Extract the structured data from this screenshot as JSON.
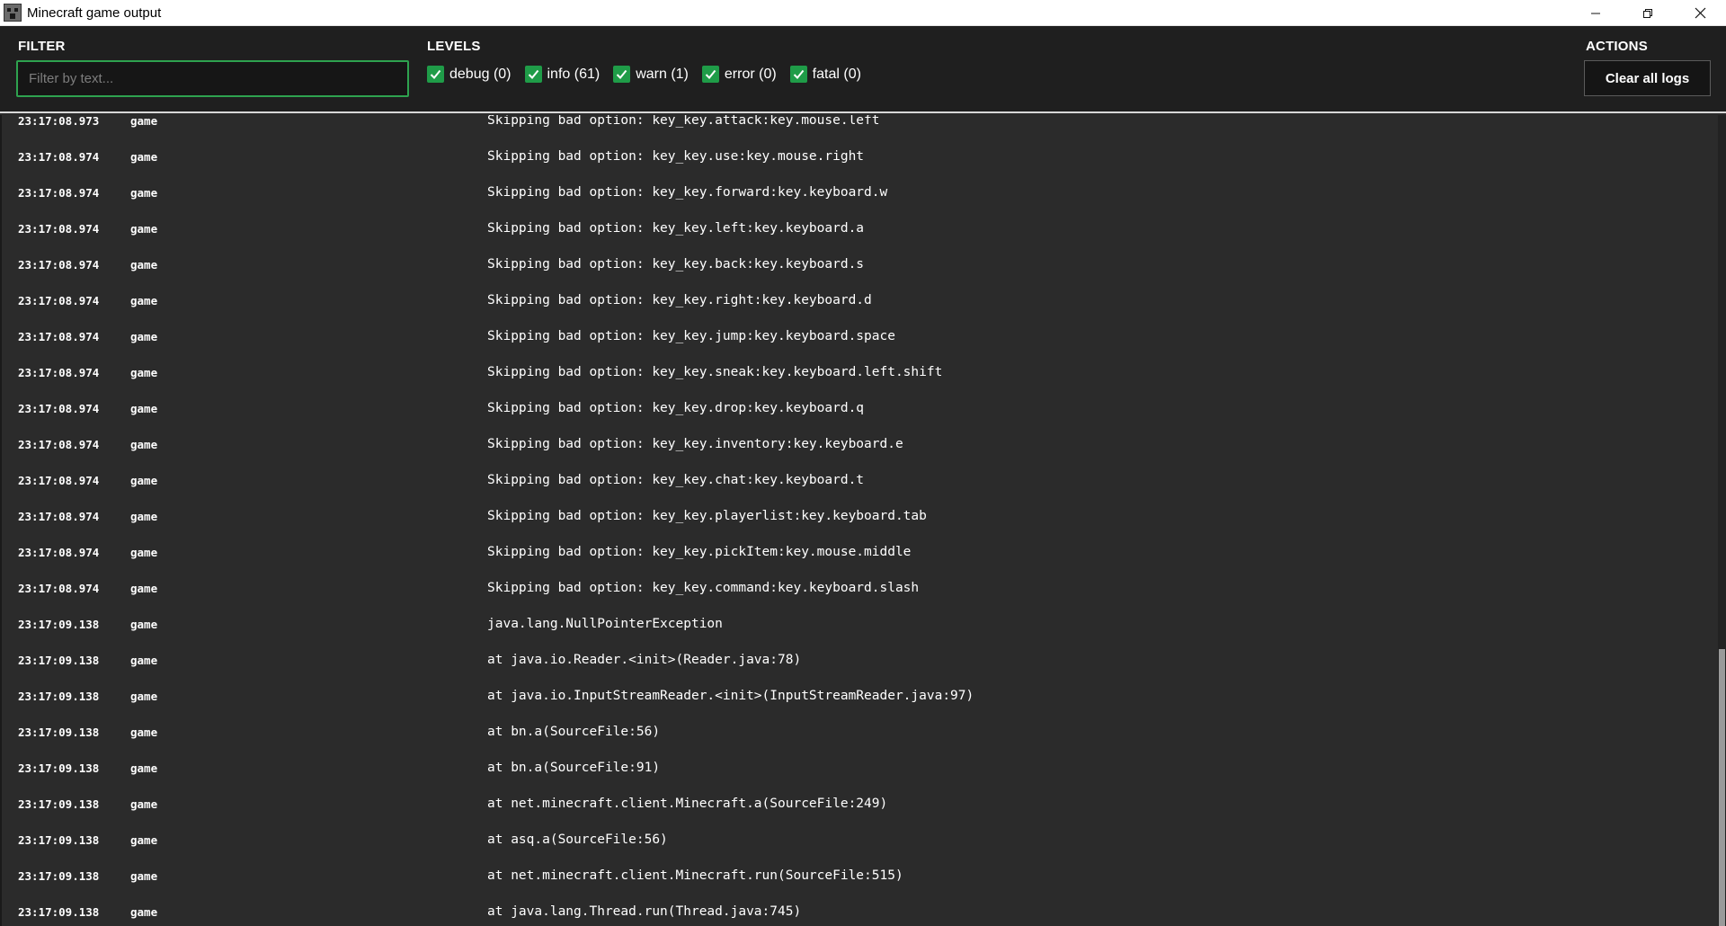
{
  "window": {
    "title": "Minecraft game output",
    "controls": [
      "minimize",
      "restore",
      "close"
    ]
  },
  "header": {
    "filter_label": "FILTER",
    "filter_placeholder": "Filter by text...",
    "filter_value": "",
    "levels_label": "LEVELS",
    "levels": [
      {
        "label": "debug (0)",
        "checked": true
      },
      {
        "label": "info (61)",
        "checked": true
      },
      {
        "label": "warn (1)",
        "checked": true
      },
      {
        "label": "error (0)",
        "checked": true
      },
      {
        "label": "fatal (0)",
        "checked": true
      }
    ],
    "actions_label": "ACTIONS",
    "clear_button": "Clear all logs"
  },
  "colors": {
    "accent": "#1f9c48",
    "filter_border": "#2ea24f",
    "background": "#2b2b2b",
    "header_bg": "#1f1f1f"
  },
  "logs": [
    {
      "time": "23:17:08.973",
      "source": "game",
      "message": "Skipping bad option: key_key.attack:key.mouse.left"
    },
    {
      "time": "23:17:08.974",
      "source": "game",
      "message": "Skipping bad option: key_key.use:key.mouse.right"
    },
    {
      "time": "23:17:08.974",
      "source": "game",
      "message": "Skipping bad option: key_key.forward:key.keyboard.w"
    },
    {
      "time": "23:17:08.974",
      "source": "game",
      "message": "Skipping bad option: key_key.left:key.keyboard.a"
    },
    {
      "time": "23:17:08.974",
      "source": "game",
      "message": "Skipping bad option: key_key.back:key.keyboard.s"
    },
    {
      "time": "23:17:08.974",
      "source": "game",
      "message": "Skipping bad option: key_key.right:key.keyboard.d"
    },
    {
      "time": "23:17:08.974",
      "source": "game",
      "message": "Skipping bad option: key_key.jump:key.keyboard.space"
    },
    {
      "time": "23:17:08.974",
      "source": "game",
      "message": "Skipping bad option: key_key.sneak:key.keyboard.left.shift"
    },
    {
      "time": "23:17:08.974",
      "source": "game",
      "message": "Skipping bad option: key_key.drop:key.keyboard.q"
    },
    {
      "time": "23:17:08.974",
      "source": "game",
      "message": "Skipping bad option: key_key.inventory:key.keyboard.e"
    },
    {
      "time": "23:17:08.974",
      "source": "game",
      "message": "Skipping bad option: key_key.chat:key.keyboard.t"
    },
    {
      "time": "23:17:08.974",
      "source": "game",
      "message": "Skipping bad option: key_key.playerlist:key.keyboard.tab"
    },
    {
      "time": "23:17:08.974",
      "source": "game",
      "message": "Skipping bad option: key_key.pickItem:key.mouse.middle"
    },
    {
      "time": "23:17:08.974",
      "source": "game",
      "message": "Skipping bad option: key_key.command:key.keyboard.slash"
    },
    {
      "time": "23:17:09.138",
      "source": "game",
      "message": "java.lang.NullPointerException"
    },
    {
      "time": "23:17:09.138",
      "source": "game",
      "message": "at java.io.Reader.<init>(Reader.java:78)"
    },
    {
      "time": "23:17:09.138",
      "source": "game",
      "message": "at java.io.InputStreamReader.<init>(InputStreamReader.java:97)"
    },
    {
      "time": "23:17:09.138",
      "source": "game",
      "message": "at bn.a(SourceFile:56)"
    },
    {
      "time": "23:17:09.138",
      "source": "game",
      "message": "at bn.a(SourceFile:91)"
    },
    {
      "time": "23:17:09.138",
      "source": "game",
      "message": "at net.minecraft.client.Minecraft.a(SourceFile:249)"
    },
    {
      "time": "23:17:09.138",
      "source": "game",
      "message": "at asq.a(SourceFile:56)"
    },
    {
      "time": "23:17:09.138",
      "source": "game",
      "message": "at net.minecraft.client.Minecraft.run(SourceFile:515)"
    },
    {
      "time": "23:17:09.138",
      "source": "game",
      "message": "at java.lang.Thread.run(Thread.java:745)"
    }
  ]
}
